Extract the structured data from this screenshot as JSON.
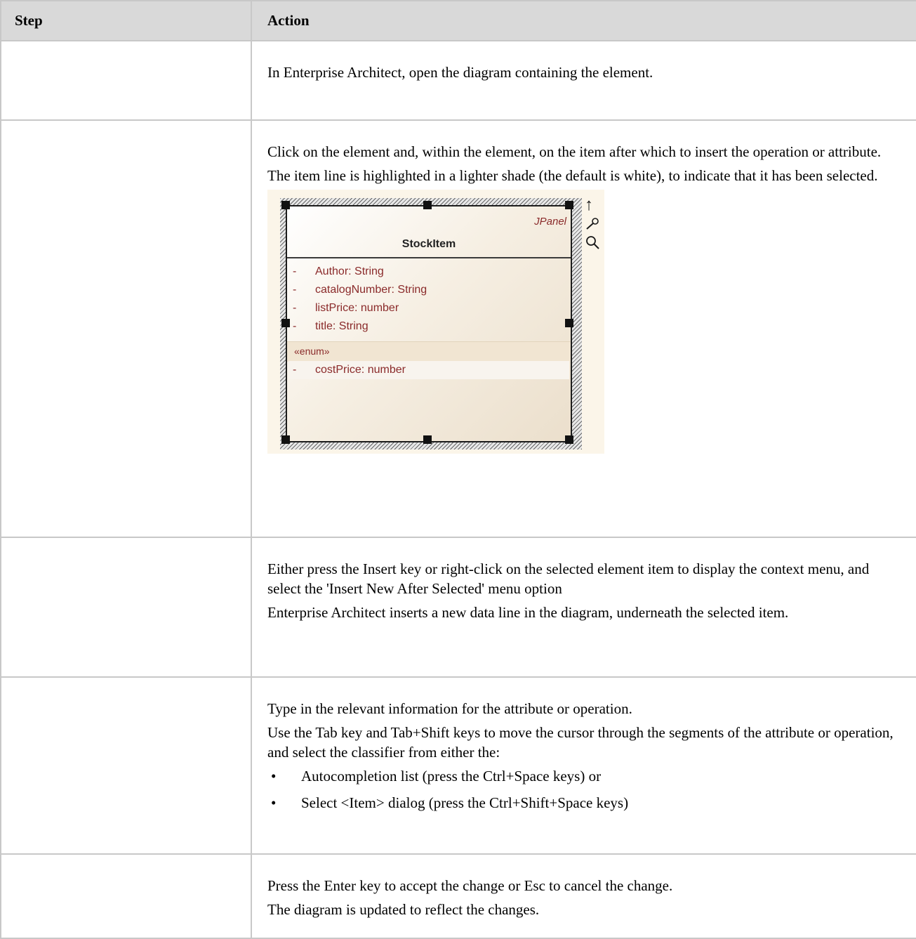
{
  "table": {
    "headers": {
      "step": "Step",
      "action": "Action"
    },
    "rows": [
      {
        "step": "",
        "paragraphs": [
          "In Enterprise Architect, open the diagram containing the element."
        ]
      },
      {
        "step": "",
        "paragraphs": [
          "Click on the element and, within the element, on the item after which to insert the operation or attribute.",
          "The item line is highlighted in a lighter shade (the default is white), to indicate that it has been selected."
        ],
        "diagram": {
          "stereotype": "JPanel",
          "class_name": "StockItem",
          "attributes": [
            {
              "visibility": "-",
              "text": "Author: String"
            },
            {
              "visibility": "-",
              "text": "catalogNumber: String"
            },
            {
              "visibility": "-",
              "text": "listPrice: number"
            },
            {
              "visibility": "-",
              "text": "title: String"
            }
          ],
          "enum_label": "«enum»",
          "enum_item": {
            "visibility": "-",
            "text": "costPrice: number"
          },
          "icons": [
            "up-arrow-icon",
            "paintbrush-icon",
            "magnifier-icon"
          ]
        }
      },
      {
        "step": "",
        "paragraphs": [
          "Either press the Insert key or right-click on the selected element item to display the context menu, and select the 'Insert New After Selected' menu option",
          "Enterprise Architect inserts a new data line in the diagram, underneath the selected item."
        ]
      },
      {
        "step": "",
        "paragraphs": [
          "Type in the relevant information for the attribute or operation.",
          "Use the Tab key and Tab+Shift keys to move the cursor through the segments of the attribute or operation, and select the classifier from either the:"
        ],
        "bullets": [
          "Autocompletion list (press the Ctrl+Space keys) or",
          "Select <Item> dialog (press the Ctrl+Shift+Space keys)"
        ]
      },
      {
        "step": "",
        "paragraphs": [
          "Press the Enter key to accept the change or Esc to cancel the change.",
          "The diagram is updated to reflect the changes."
        ]
      }
    ]
  },
  "colors": {
    "header_bg": "#d9d9d9",
    "border": "#c8c8c8",
    "diagram_text": "#8a2a2a"
  }
}
